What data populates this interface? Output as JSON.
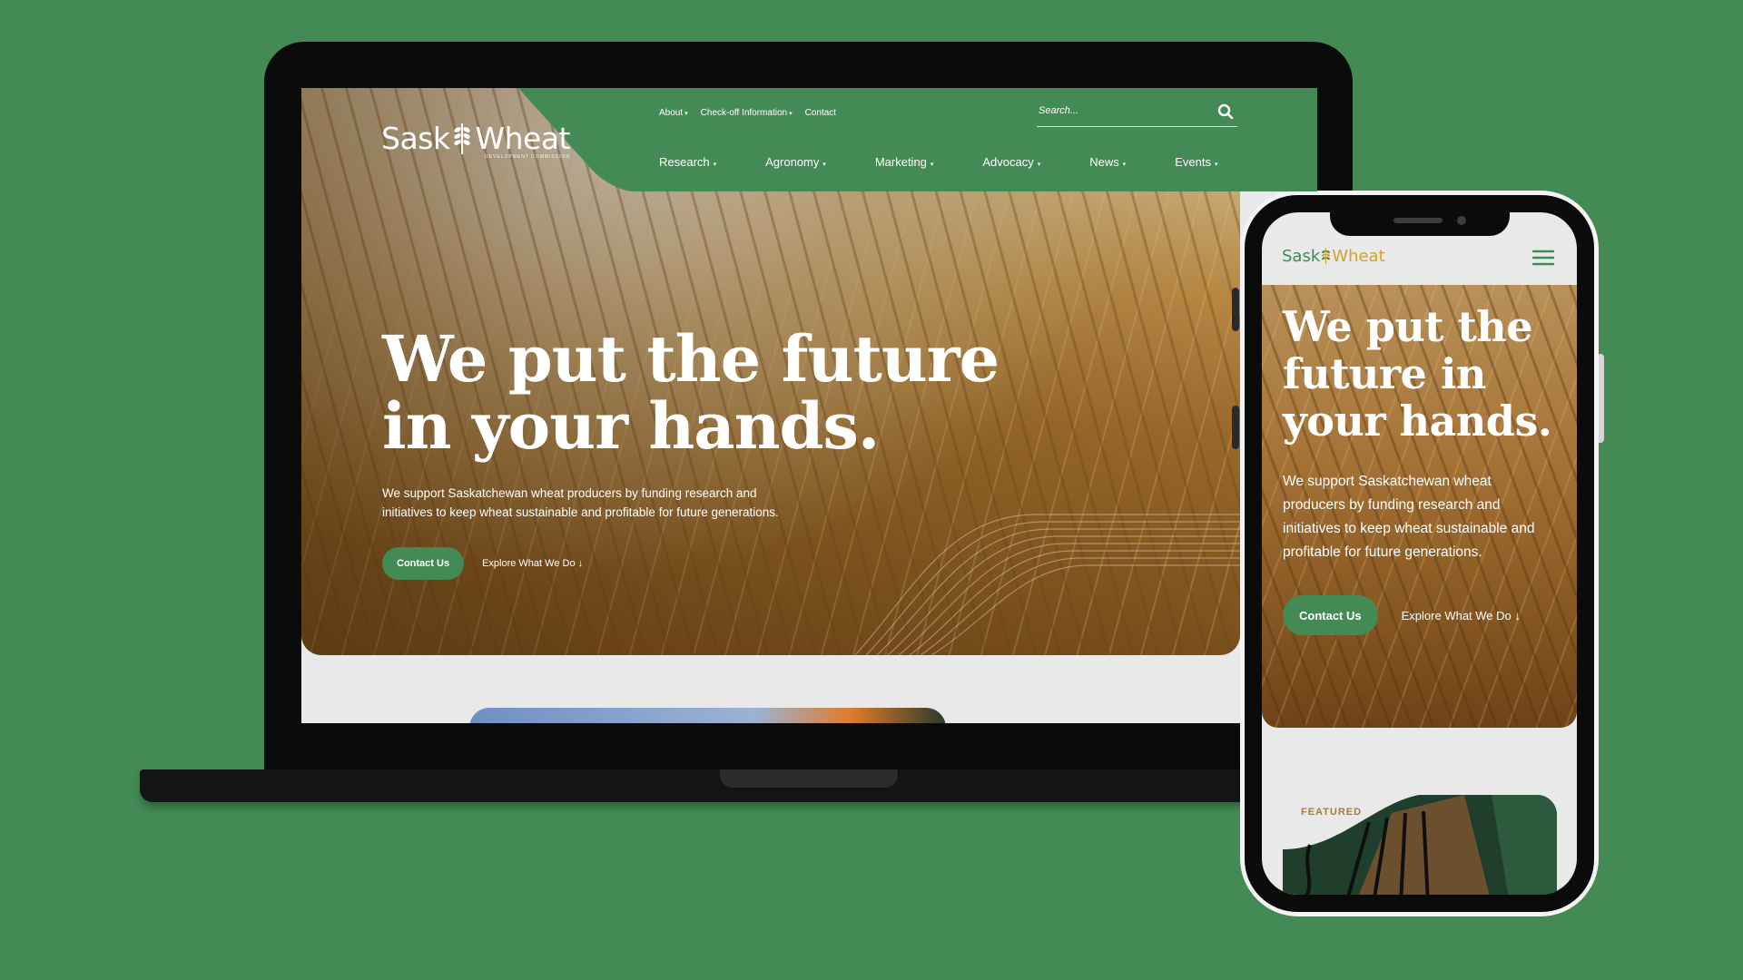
{
  "desktop": {
    "logo": {
      "text_left": "Sask",
      "text_right": "Wheat",
      "subtitle": "DEVELOPMENT COMMISSION"
    },
    "utility_nav": [
      {
        "label": "About",
        "has_dropdown": true
      },
      {
        "label": "Check-off Information",
        "has_dropdown": true
      },
      {
        "label": "Contact",
        "has_dropdown": false
      }
    ],
    "search": {
      "placeholder": "Search...",
      "icon": "search-icon"
    },
    "main_nav": [
      {
        "label": "Research"
      },
      {
        "label": "Agronomy"
      },
      {
        "label": "Marketing"
      },
      {
        "label": "Advocacy"
      },
      {
        "label": "News"
      },
      {
        "label": "Events"
      }
    ],
    "hero": {
      "title": "We put the future in your hands.",
      "description": "We support Saskatchewan wheat producers by funding research and initiatives to keep wheat sustainable and profitable for future generations.",
      "cta_primary": "Contact Us",
      "cta_secondary": "Explore What We Do"
    }
  },
  "mobile": {
    "logo": {
      "text_left": "Sask",
      "text_right": "Wheat"
    },
    "menu_icon": "hamburger-menu-icon",
    "hero": {
      "title": "We put the future in your hands.",
      "description": "We support Saskatchewan wheat producers by funding research and initiatives to keep wheat sustainable and profitable for future generations.",
      "cta_primary": "Contact Us",
      "cta_secondary": "Explore What We Do"
    },
    "featured_label": "FEATURED"
  },
  "colors": {
    "brand_green": "#438a55",
    "wheat_gold": "#d4a02a",
    "background": "#438a55",
    "device_black": "#0b0b0b"
  }
}
